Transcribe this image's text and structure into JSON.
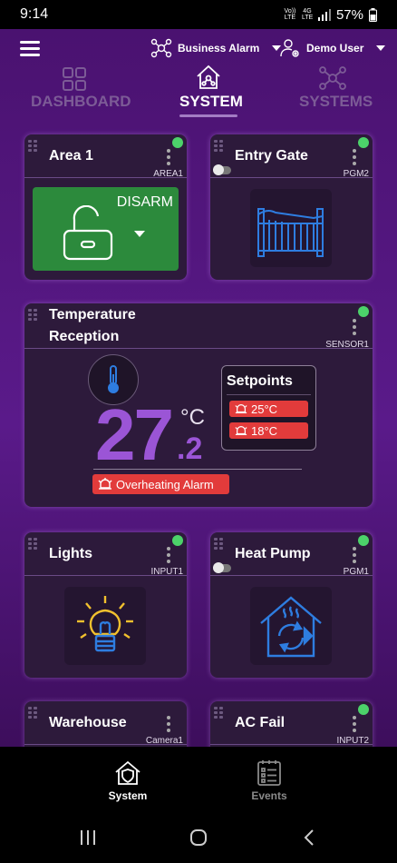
{
  "status_bar": {
    "time": "9:14",
    "battery": "57%",
    "net1": "Vo)) LTE",
    "net2": "4G LTE"
  },
  "header": {
    "site_selector": "Business Alarm",
    "user_selector": "Demo User"
  },
  "tabs": [
    {
      "label": "DASHBOARD"
    },
    {
      "label": "SYSTEM"
    },
    {
      "label": "SYSTEMS"
    }
  ],
  "cards": {
    "area1": {
      "title": "Area 1",
      "code": "AREA1",
      "action": "DISARM"
    },
    "entry_gate": {
      "title": "Entry Gate",
      "code": "PGM2"
    },
    "temperature": {
      "title_line1": "Temperature",
      "title_line2": "Reception",
      "code": "SENSOR1",
      "value_int": "27",
      "value_dec": ".2",
      "unit": "°C",
      "setpoints_title": "Setpoints",
      "setpoint_high": "25°C",
      "setpoint_low": "18°C",
      "alarm": "Overheating Alarm"
    },
    "lights": {
      "title": "Lights",
      "code": "INPUT1"
    },
    "heat_pump": {
      "title": "Heat Pump",
      "code": "PGM1"
    },
    "warehouse": {
      "title": "Warehouse",
      "code": "Camera1"
    },
    "ac_fail": {
      "title": "AC Fail",
      "code": "INPUT2"
    }
  },
  "bottom_nav": {
    "system": "System",
    "events": "Events"
  },
  "colors": {
    "accent": "#a37cc4",
    "online": "#4cd26a",
    "disarm": "#2c8a3c",
    "alarm": "#e23b3b",
    "temp": "#9b55d6",
    "icon_blue": "#2e7de0"
  }
}
